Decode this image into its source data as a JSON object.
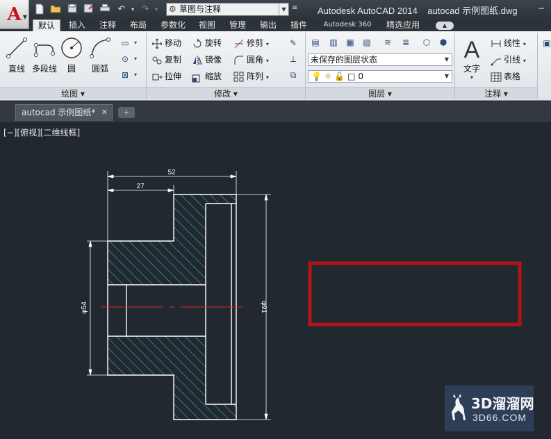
{
  "window": {
    "title": "Autodesk AutoCAD 2014    autocad 示例图纸.dwg",
    "workspace": "草图与注释",
    "app_logo": "A"
  },
  "ribbon_tabs": [
    {
      "label": "默认",
      "active": true
    },
    {
      "label": "插入"
    },
    {
      "label": "注释"
    },
    {
      "label": "布局"
    },
    {
      "label": "参数化"
    },
    {
      "label": "视图"
    },
    {
      "label": "管理"
    },
    {
      "label": "输出"
    },
    {
      "label": "插件"
    },
    {
      "label": "Autodesk 360"
    },
    {
      "label": "精选应用"
    }
  ],
  "panels": {
    "draw": {
      "title": "绘图 ▾",
      "tools": {
        "line": "直线",
        "polyline": "多段线",
        "circle": "圆",
        "arc": "圆弧"
      }
    },
    "modify": {
      "title": "修改 ▾",
      "tools": {
        "move": "移动",
        "rotate": "旋转",
        "trim": "修剪",
        "copy": "复制",
        "mirror": "镜像",
        "fillet": "圆角",
        "stretch": "拉伸",
        "scale": "缩放",
        "array": "阵列"
      }
    },
    "layers": {
      "title": "图层 ▾",
      "state": "未保存的图层状态",
      "current_layer": "0"
    },
    "annotation": {
      "title": "注释 ▾",
      "tools": {
        "text": "文字",
        "linear": "线性",
        "leader": "引线",
        "table": "表格"
      }
    }
  },
  "document": {
    "tab_title": "autocad 示例图纸*",
    "viewport_label": "[−][俯视][二维线框]"
  },
  "drawing": {
    "dimensions": {
      "overall_width": "52",
      "left_width": "27",
      "left_diameter": "φ54",
      "right_diameter": "φ91"
    },
    "colors": {
      "outline": "#ffffff",
      "hatch": "#41c8c8",
      "centerline": "#e0222a",
      "highlight_box": "#b01418",
      "dimension": "#ffffff"
    }
  },
  "watermark": {
    "name": "3D溜溜网",
    "url": "3D66.COM"
  }
}
